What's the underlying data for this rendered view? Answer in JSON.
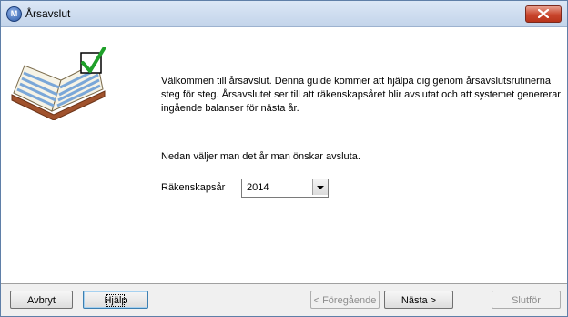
{
  "window": {
    "title": "Årsavslut"
  },
  "intro_text": "Välkommen till årsavslut. Denna guide kommer att hjälpa dig genom årsavslutsrutinerna steg för steg. Årsavslutet ser till att räkenskapsåret blir avslutat och att systemet genererar ingående balanser för nästa år.",
  "choose_text": "Nedan väljer man det år man önskar avsluta.",
  "year_field": {
    "label": "Räkenskapsår",
    "value": "2014"
  },
  "buttons": {
    "cancel": "Avbryt",
    "help": "Hjälp",
    "previous": "< Föregående",
    "next": "Nästa >",
    "finish": "Slutför"
  },
  "icons": {
    "app": "app-logo-icon",
    "close": "close-icon",
    "illustration": "open-book-checkmark-icon",
    "dropdown": "chevron-down-icon"
  },
  "colors": {
    "titlebar": "#c3d4ea",
    "close": "#c9452c",
    "checkmark": "#1fa02a"
  }
}
